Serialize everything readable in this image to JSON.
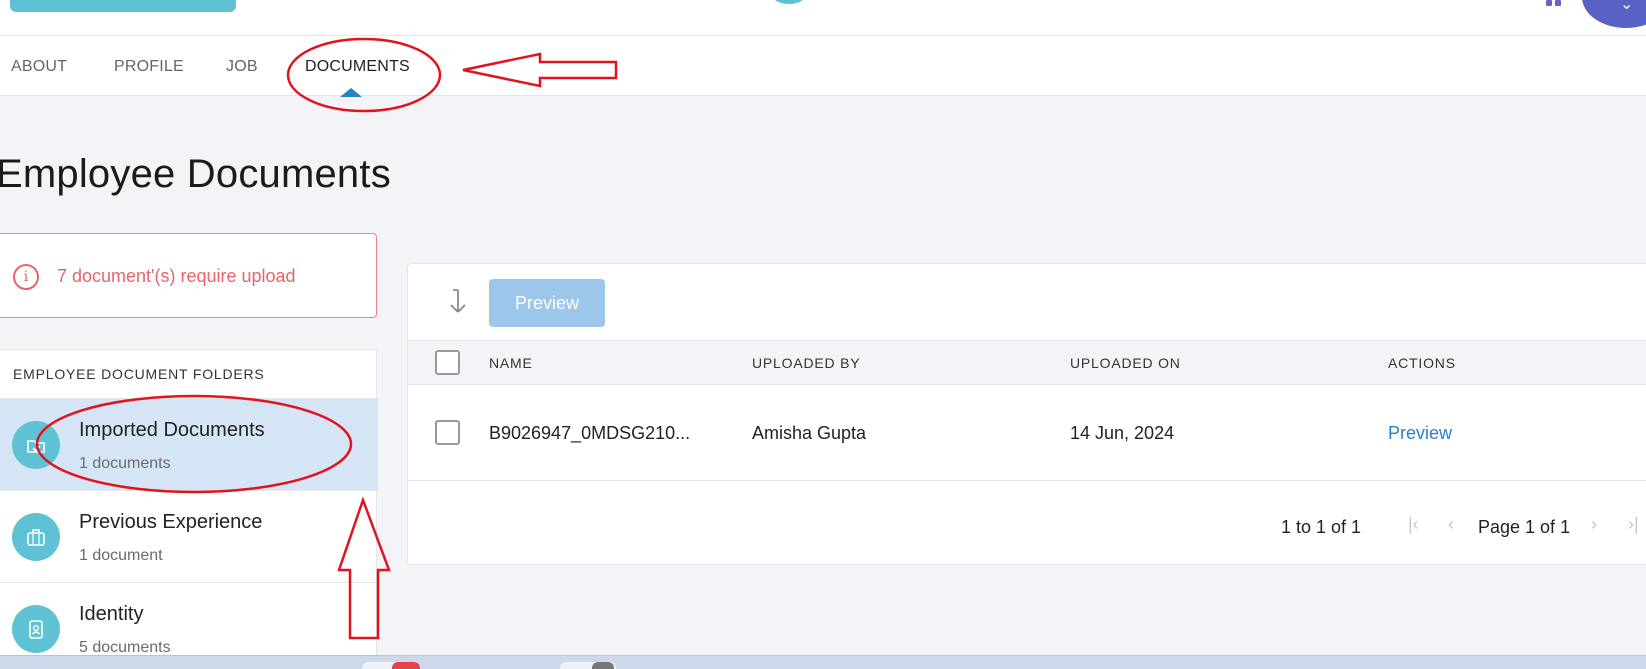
{
  "tabs": [
    {
      "label": "ABOUT"
    },
    {
      "label": "PROFILE"
    },
    {
      "label": "JOB"
    },
    {
      "label": "DOCUMENTS",
      "active": true
    }
  ],
  "page": {
    "title": "Employee Documents"
  },
  "alert": {
    "text": "7 document'(s) require upload",
    "icon": "info-icon",
    "color": "#e8636b"
  },
  "folders": {
    "header": "EMPLOYEE DOCUMENT FOLDERS",
    "items": [
      {
        "name": "Imported Documents",
        "count": "1 documents",
        "icon": "folder-import-icon",
        "selected": true
      },
      {
        "name": "Previous Experience",
        "count": "1 document",
        "icon": "briefcase-icon"
      },
      {
        "name": "Identity",
        "count": "5 documents",
        "icon": "id-badge-icon"
      }
    ]
  },
  "toolbar": {
    "preview_label": "Preview",
    "sort_icon": "sort-arrow-icon"
  },
  "table": {
    "columns": [
      "NAME",
      "UPLOADED BY",
      "UPLOADED ON",
      "ACTIONS"
    ],
    "rows": [
      {
        "name": "B9026947_0MDSG210...",
        "uploaded_by": "Amisha Gupta",
        "uploaded_on": "14 Jun, 2024",
        "action": "Preview"
      }
    ]
  },
  "pagination": {
    "range": "1 to 1 of 1",
    "page": "Page 1 of 1"
  },
  "colors": {
    "accent": "#5ec2d4",
    "link": "#2a7fc6",
    "selected_row": "#d6e5f5",
    "annotation": "#e0141e"
  }
}
